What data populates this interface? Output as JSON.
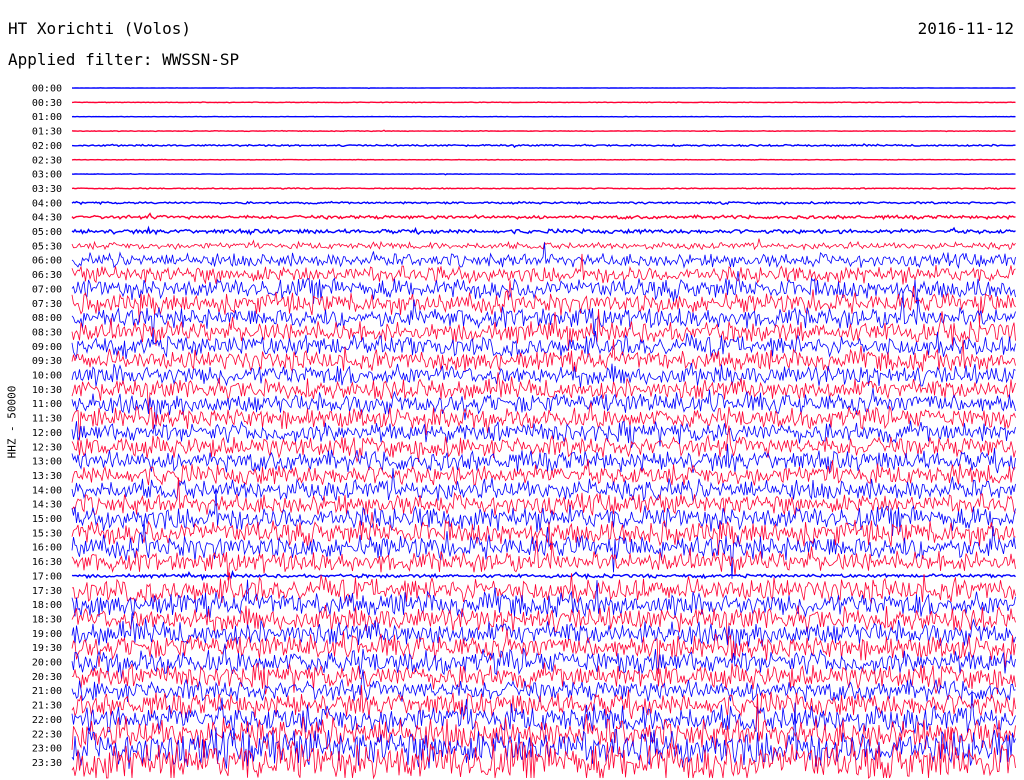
{
  "header": {
    "station": "HT Xorichti (Volos)",
    "date": "2016-11-12",
    "filter": "Applied filter: WWSSN-SP"
  },
  "chart_data": {
    "type": "line",
    "ylabel": "HHZ - 50000",
    "colors": [
      "#0000ff",
      "#ff0033"
    ],
    "rows": [
      "00:00",
      "00:30",
      "01:00",
      "01:30",
      "02:00",
      "02:30",
      "03:00",
      "03:30",
      "04:00",
      "04:30",
      "05:00",
      "05:30",
      "06:00",
      "06:30",
      "07:00",
      "07:30",
      "08:00",
      "08:30",
      "09:00",
      "09:30",
      "10:00",
      "10:30",
      "11:00",
      "11:30",
      "12:00",
      "12:30",
      "13:00",
      "13:30",
      "14:00",
      "14:30",
      "15:00",
      "15:30",
      "16:00",
      "16:30",
      "17:00",
      "17:30",
      "18:00",
      "18:30",
      "19:00",
      "19:30",
      "20:00",
      "20:30",
      "21:00",
      "21:30",
      "22:00",
      "22:30",
      "23:00",
      "23:30"
    ],
    "amplitude": [
      0.2,
      0.3,
      0.2,
      0.4,
      1.0,
      0.3,
      0.3,
      0.6,
      1.2,
      2.0,
      2.5,
      4.0,
      8,
      10,
      12,
      12,
      12,
      12,
      12,
      12,
      12,
      12,
      12,
      12,
      12,
      12,
      12,
      12,
      12,
      12,
      14,
      14,
      14,
      12,
      2,
      14,
      14,
      14,
      14,
      14,
      14,
      14,
      12,
      14,
      16,
      18,
      22,
      24
    ]
  }
}
